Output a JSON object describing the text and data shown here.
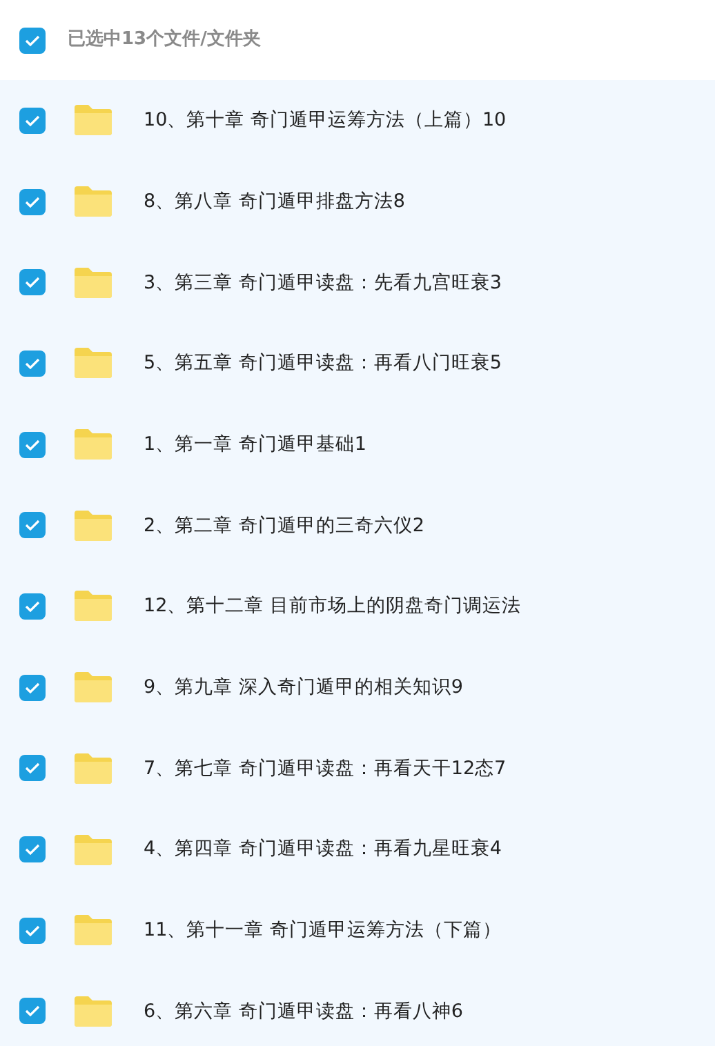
{
  "header": {
    "checked": true,
    "label": "已选中13个文件/文件夹"
  },
  "files": [
    {
      "name": "10、第十章 奇门遁甲运筹方法（上篇）10",
      "checked": true
    },
    {
      "name": "8、第八章 奇门遁甲排盘方法8",
      "checked": true
    },
    {
      "name": "3、第三章 奇门遁甲读盘：先看九宫旺衰3",
      "checked": true
    },
    {
      "name": "5、第五章 奇门遁甲读盘：再看八门旺衰5",
      "checked": true
    },
    {
      "name": "1、第一章 奇门遁甲基础1",
      "checked": true
    },
    {
      "name": "2、第二章 奇门遁甲的三奇六仪2",
      "checked": true
    },
    {
      "name": "12、第十二章 目前市场上的阴盘奇门调运法",
      "checked": true
    },
    {
      "name": "9、第九章 深入奇门遁甲的相关知识9",
      "checked": true
    },
    {
      "name": "7、第七章 奇门遁甲读盘：再看天干12态7",
      "checked": true
    },
    {
      "name": "4、第四章 奇门遁甲读盘：再看九星旺衰4",
      "checked": true
    },
    {
      "name": "11、第十一章 奇门遁甲运筹方法（下篇）",
      "checked": true
    },
    {
      "name": "6、第六章 奇门遁甲读盘：再看八神6",
      "checked": true
    }
  ]
}
